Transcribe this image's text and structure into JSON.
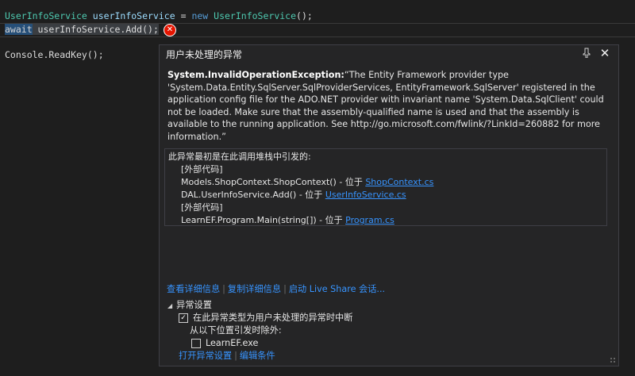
{
  "code": {
    "line1": {
      "type": "UserInfoService",
      "ident": "userInfoService",
      "assign": " = ",
      "kw_new": "new",
      "ctor": "UserInfoService",
      "tail": "();"
    },
    "line2": {
      "kw_await": "await",
      "rest": " userInfoService.Add();"
    },
    "line3": {
      "text": "Console.ReadKey();"
    }
  },
  "popup": {
    "title": "用户未处理的异常",
    "exception_type": "System.InvalidOperationException:",
    "message": "“The Entity Framework provider type 'System.Data.Entity.SqlServer.SqlProviderServices, EntityFramework.SqlServer' registered in the application config file for the ADO.NET provider with invariant name 'System.Data.SqlClient' could not be loaded. Make sure that the assembly-qualified name is used and that the assembly is available to the running application. See http://go.microsoft.com/fwlink/?LinkId=260882 for more information.”",
    "stack_header": "此异常最初是在此调用堆栈中引发的:",
    "stack": [
      {
        "text": "[外部代码]",
        "link": ""
      },
      {
        "text": "Models.ShopContext.ShopContext() - 位于 ",
        "link": "ShopContext.cs"
      },
      {
        "text": "DAL.UserInfoService.Add() - 位于 ",
        "link": "UserInfoService.cs"
      },
      {
        "text": "[外部代码]",
        "link": ""
      },
      {
        "text": "LearnEF.Program.Main(string[]) - 位于 ",
        "link": "Program.cs"
      }
    ],
    "actions": [
      "查看详细信息",
      "复制详细信息",
      "启动 Live Share 会话..."
    ],
    "settings_title": "异常设置",
    "option_break": "在此异常类型为用户未处理的异常时中断",
    "option_break_checked": true,
    "except_label": "从以下位置引发时除外:",
    "option_exe": "LearnEF.exe",
    "option_exe_checked": false,
    "bottom_links": [
      "打开异常设置",
      "编辑条件"
    ]
  },
  "icons": {
    "pin": "pin-icon",
    "close": "close-icon",
    "error": "error-icon"
  },
  "colors": {
    "link": "#3794ff",
    "error": "#e51400",
    "background": "#1e1e1e"
  }
}
